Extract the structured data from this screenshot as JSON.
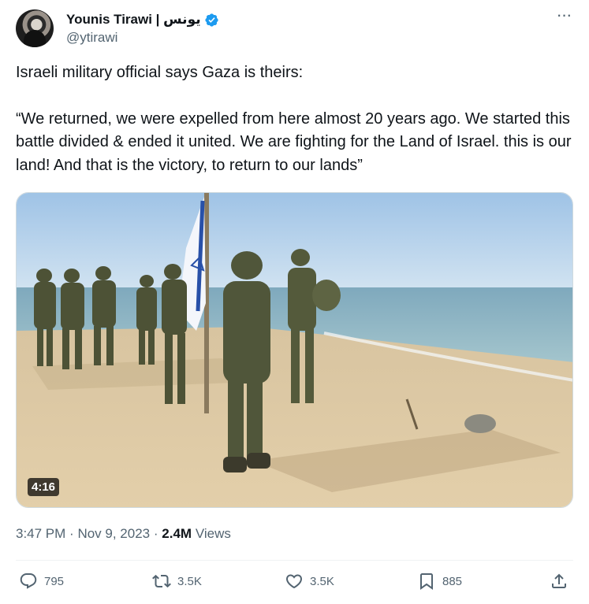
{
  "user": {
    "display_name": "Younis Tirawi | يونس",
    "handle": "@ytirawi"
  },
  "tweet": {
    "line1": "Israeli military official says Gaza is theirs:",
    "quote": "“We returned, we were expelled from here almost 20 years ago. We started this battle divided & ended it united. We are fighting for the Land of Israel. this is our land! And that is the victory, to return to our lands”"
  },
  "media": {
    "duration": "4:16"
  },
  "meta": {
    "time": "3:47 PM",
    "sep": "·",
    "date": "Nov 9, 2023",
    "views_count": "2.4M",
    "views_label": "Views"
  },
  "actions": {
    "reply_count": "795",
    "repost_count": "3.5K",
    "like_count": "3.5K",
    "bookmark_count": "885"
  },
  "colors": {
    "accent": "#1d9bf0",
    "secondary_text": "#536471",
    "primary_text": "#0f1419"
  }
}
